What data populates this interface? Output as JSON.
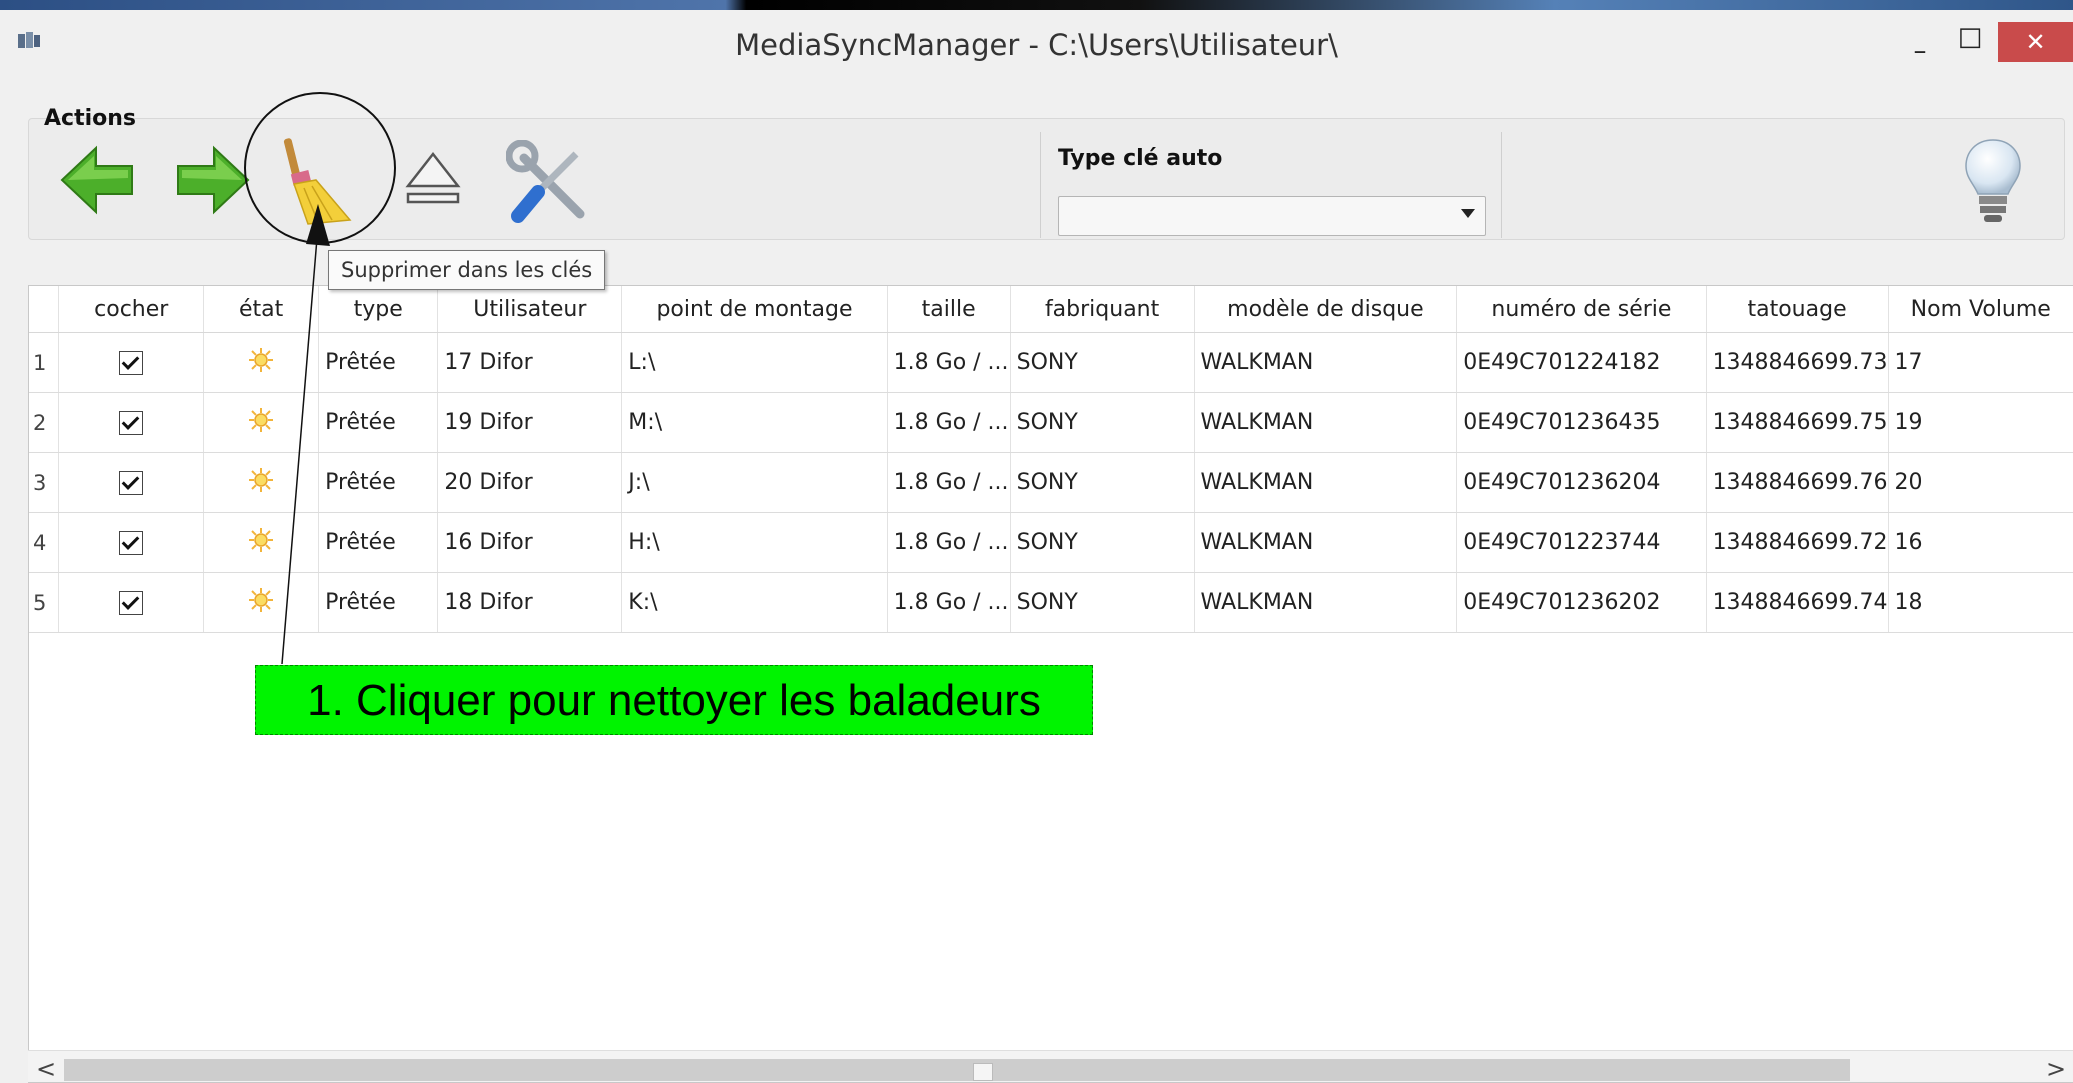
{
  "window": {
    "title": "MediaSyncManager - C:\\Users\\Utilisateur\\",
    "minimize_glyph": "–",
    "maximize_glyph": "□",
    "close_glyph": "✕"
  },
  "actions": {
    "label": "Actions",
    "tools": [
      {
        "icon": "arrow-left-icon"
      },
      {
        "icon": "arrow-right-icon"
      },
      {
        "icon": "broom-icon"
      },
      {
        "icon": "eject-icon"
      },
      {
        "icon": "tools-icon"
      }
    ],
    "lightbulb_icon": "lightbulb-icon"
  },
  "combo": {
    "label": "Type clé auto",
    "value": ""
  },
  "tooltip": {
    "text": "Supprimer dans les clés"
  },
  "table": {
    "columns": [
      "",
      "cocher",
      "état",
      "type",
      "Utilisateur",
      "point de montage",
      "taille",
      "fabriquant",
      "modèle de disque",
      "numéro de série",
      "tatouage",
      "Nom Volume"
    ],
    "rows": [
      {
        "n": "1",
        "checked": true,
        "state_icon": "sun-icon",
        "type": "Prêtée",
        "user": "17 Difor",
        "mount": "L:\\",
        "size": "1.8 Go / ...",
        "maker": "SONY",
        "model": "WALKMAN",
        "serial": "0E49C701224182",
        "watermark": "1348846699.73",
        "volume": "17"
      },
      {
        "n": "2",
        "checked": true,
        "state_icon": "sun-icon",
        "type": "Prêtée",
        "user": "19 Difor",
        "mount": "M:\\",
        "size": "1.8 Go / ...",
        "maker": "SONY",
        "model": "WALKMAN",
        "serial": "0E49C701236435",
        "watermark": "1348846699.75",
        "volume": "19"
      },
      {
        "n": "3",
        "checked": true,
        "state_icon": "sun-icon",
        "type": "Prêtée",
        "user": "20 Difor",
        "mount": "J:\\",
        "size": "1.8 Go / ...",
        "maker": "SONY",
        "model": "WALKMAN",
        "serial": "0E49C701236204",
        "watermark": "1348846699.76",
        "volume": "20"
      },
      {
        "n": "4",
        "checked": true,
        "state_icon": "sun-icon",
        "type": "Prêtée",
        "user": "16 Difor",
        "mount": "H:\\",
        "size": "1.8 Go / ...",
        "maker": "SONY",
        "model": "WALKMAN",
        "serial": "0E49C701223744",
        "watermark": "1348846699.72",
        "volume": "16"
      },
      {
        "n": "5",
        "checked": true,
        "state_icon": "sun-icon",
        "type": "Prêtée",
        "user": "18 Difor",
        "mount": "K:\\",
        "size": "1.8 Go / ...",
        "maker": "SONY",
        "model": "WALKMAN",
        "serial": "0E49C701236202",
        "watermark": "1348846699.74",
        "volume": "18"
      }
    ]
  },
  "scrollbar": {
    "left_glyph": "<",
    "right_glyph": ">"
  },
  "annotation": {
    "text": "1. Cliquer pour nettoyer les baladeurs"
  },
  "colors": {
    "annotation_bg": "#00f400",
    "arrow_green": "#4caf2a",
    "close_button": "#c94b4b"
  }
}
